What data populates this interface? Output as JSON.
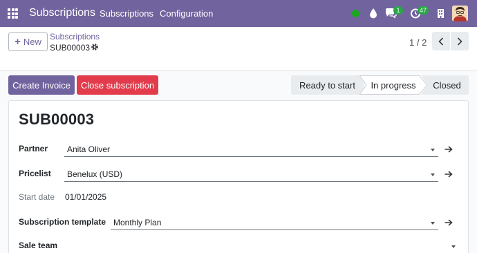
{
  "navbar": {
    "brand": "Subscriptions",
    "menu": [
      "Subscriptions",
      "Configuration"
    ],
    "chat_badge": "1",
    "activity_badge": "47",
    "colors": {
      "bg": "#71639e",
      "badge": "#28a745",
      "online": "#18a81c"
    }
  },
  "control": {
    "new_label": "New",
    "breadcrumb_parent": "Subscriptions",
    "record_ref": "SUB00003",
    "pager": "1 / 2"
  },
  "actions": {
    "create_invoice": "Create Invoice",
    "close_subscription": "Close subscription"
  },
  "statusbar": {
    "stages": [
      "Ready to start",
      "In progress",
      "Closed"
    ],
    "current": "In progress"
  },
  "form": {
    "title": "SUB00003",
    "partner_label": "Partner",
    "partner_value": "Anita Oliver",
    "pricelist_label": "Pricelist",
    "pricelist_value": "Benelux (USD)",
    "start_date_label": "Start date",
    "start_date_value": "01/01/2025",
    "template_label": "Subscription template",
    "template_value": "Monthly Plan",
    "sale_team_label": "Sale team",
    "sale_team_value": ""
  },
  "icons": [
    "apps-grid-icon",
    "online-status-icon",
    "drop-icon",
    "chat-icon",
    "activity-clock-icon",
    "company-building-icon",
    "user-avatar",
    "plus-icon",
    "gear-icon",
    "chevron-left-icon",
    "chevron-right-icon",
    "dropdown-caret-icon",
    "arrow-right-icon"
  ]
}
